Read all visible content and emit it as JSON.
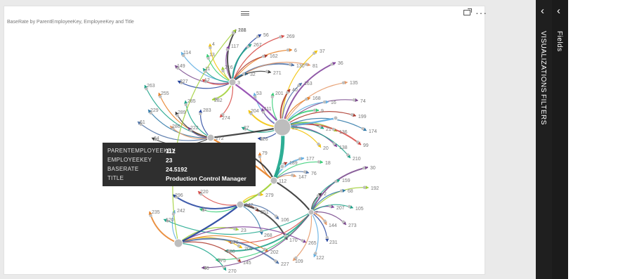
{
  "visual": {
    "title": "BaseRate by ParentEmployeeKey, EmployeeKey and Title",
    "more_label": "···"
  },
  "tooltip": {
    "rows": [
      {
        "key": "PARENTEMPLOYEEKEY",
        "value": "112"
      },
      {
        "key": "EMPLOYEEKEY",
        "value": "23"
      },
      {
        "key": "BASERATE",
        "value": "24.5192"
      },
      {
        "key": "TITLE",
        "value": "Production Control Manager"
      }
    ]
  },
  "panes": {
    "visualizations_label": "VISUALIZATIONS",
    "filters_label": "FILTERS",
    "fields_label": "Fields",
    "collapse_glyph": "‹"
  },
  "graph": {
    "hubs": [
      {
        "id": "3",
        "label": "3"
      },
      {
        "id": "112",
        "label": "112"
      },
      {
        "id": "272",
        "label": "272"
      },
      {
        "id": "142",
        "label": "142"
      },
      {
        "id": "big",
        "label": "23"
      },
      {
        "id": "lowleft",
        "label": ""
      },
      {
        "id": "7",
        "label": "7"
      },
      {
        "id": "25",
        "label": ""
      },
      {
        "id": "185",
        "label": ""
      },
      {
        "id": "160",
        "label": ""
      }
    ],
    "leaves": [
      {
        "label": "221",
        "hub": "3"
      },
      {
        "label": "56",
        "hub": "3"
      },
      {
        "label": "269",
        "hub": "3"
      },
      {
        "label": "4",
        "hub": "3"
      },
      {
        "label": "117",
        "hub": "3"
      },
      {
        "label": "267",
        "hub": "3"
      },
      {
        "label": "6",
        "hub": "3"
      },
      {
        "label": "114",
        "hub": "3"
      },
      {
        "label": "13",
        "hub": "3"
      },
      {
        "label": "162",
        "hub": "3"
      },
      {
        "label": "130",
        "hub": "3"
      },
      {
        "label": "81",
        "hub": "3"
      },
      {
        "label": "149",
        "hub": "3"
      },
      {
        "label": "11",
        "hub": "3"
      },
      {
        "label": "216",
        "hub": "3"
      },
      {
        "label": "32",
        "hub": "3"
      },
      {
        "label": "271",
        "hub": "3"
      },
      {
        "label": "227",
        "hub": "3"
      },
      {
        "label": "12",
        "hub": "3"
      },
      {
        "label": "37",
        "hub": "big"
      },
      {
        "label": "36",
        "hub": "big"
      },
      {
        "label": "263",
        "hub": "272"
      },
      {
        "label": "255",
        "hub": "272"
      },
      {
        "label": "53",
        "hub": "big"
      },
      {
        "label": "201",
        "hub": "big"
      },
      {
        "label": "40",
        "hub": "big"
      },
      {
        "label": "163",
        "hub": "big"
      },
      {
        "label": "135",
        "hub": "big"
      },
      {
        "label": "74",
        "hub": "big"
      },
      {
        "label": "285",
        "hub": "272"
      },
      {
        "label": "282",
        "hub": "3"
      },
      {
        "label": "229",
        "hub": "272"
      },
      {
        "label": "289",
        "hub": "272"
      },
      {
        "label": "283",
        "hub": "272"
      },
      {
        "label": "274",
        "hub": "3"
      },
      {
        "label": "204",
        "hub": "big"
      },
      {
        "label": "111",
        "hub": "big"
      },
      {
        "label": "27",
        "hub": "big"
      },
      {
        "label": "168",
        "hub": "big"
      },
      {
        "label": "16",
        "hub": "big"
      },
      {
        "label": "9",
        "hub": "big"
      },
      {
        "label": "199",
        "hub": "big"
      },
      {
        "label": "61",
        "hub": "272"
      },
      {
        "label": "286",
        "hub": "272"
      },
      {
        "label": "222",
        "hub": "272"
      },
      {
        "label": "21",
        "hub": "big"
      },
      {
        "label": "136",
        "hub": "big"
      },
      {
        "label": "174",
        "hub": "big"
      },
      {
        "label": "84",
        "hub": "272"
      },
      {
        "label": "126",
        "hub": "big"
      },
      {
        "label": "99",
        "hub": "big"
      },
      {
        "label": "20",
        "hub": "big"
      },
      {
        "label": "138",
        "hub": "big"
      },
      {
        "label": "210",
        "hub": "big"
      },
      {
        "label": "79",
        "hub": "112"
      },
      {
        "label": "177",
        "hub": "112"
      },
      {
        "label": "18",
        "hub": "112"
      },
      {
        "label": "189",
        "hub": "112"
      },
      {
        "label": "76",
        "hub": "112"
      },
      {
        "label": "147",
        "hub": "112"
      },
      {
        "label": "30",
        "hub": "7"
      },
      {
        "label": "159",
        "hub": "7"
      },
      {
        "label": "192",
        "hub": "7"
      },
      {
        "label": "68",
        "hub": "7"
      },
      {
        "label": "2",
        "hub": "7"
      },
      {
        "label": "296",
        "hub": "142"
      },
      {
        "label": "220",
        "hub": "142"
      },
      {
        "label": "279",
        "hub": "142"
      },
      {
        "label": "207",
        "hub": "7"
      },
      {
        "label": "105",
        "hub": "7"
      },
      {
        "label": "235",
        "hub": "lowleft"
      },
      {
        "label": "242",
        "hub": "lowleft"
      },
      {
        "label": "41",
        "hub": "142"
      },
      {
        "label": "251",
        "hub": "142"
      },
      {
        "label": "106",
        "hub": "142"
      },
      {
        "label": "144",
        "hub": "7"
      },
      {
        "label": "273",
        "hub": "7"
      },
      {
        "label": "120",
        "hub": "7"
      },
      {
        "label": "23",
        "hub": "lowleft"
      },
      {
        "label": "268",
        "hub": "142"
      },
      {
        "label": "170",
        "hub": "142"
      },
      {
        "label": "231",
        "hub": "7"
      },
      {
        "label": "276",
        "hub": "7"
      },
      {
        "label": "205",
        "hub": "lowleft"
      },
      {
        "label": "265",
        "hub": "lowleft"
      },
      {
        "label": "180",
        "hub": "7"
      },
      {
        "label": "202",
        "hub": "lowleft"
      },
      {
        "label": "122",
        "hub": "7"
      },
      {
        "label": "275",
        "hub": "7"
      },
      {
        "label": "145",
        "hub": "lowleft"
      },
      {
        "label": "227",
        "hub": "lowleft"
      },
      {
        "label": "109",
        "hub": "7"
      },
      {
        "label": "46",
        "hub": "7"
      },
      {
        "label": "270",
        "hub": "lowleft"
      },
      {
        "label": "168",
        "hub": "lowleft"
      }
    ]
  },
  "colors": {
    "tooltip_bg": "#2f2f2f",
    "pane_dark": "#1f1f1f",
    "node_gray": "#bdbdbd",
    "label_gray": "#777777"
  }
}
